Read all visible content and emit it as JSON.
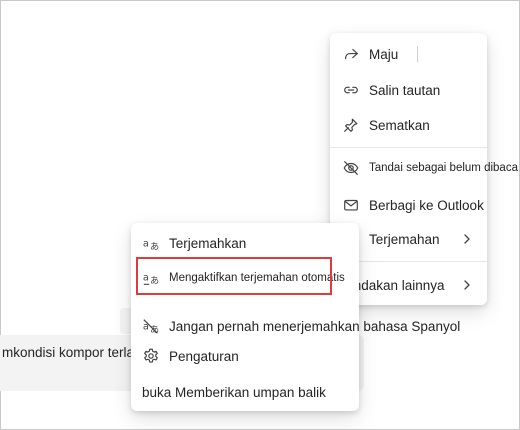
{
  "message": {
    "text": "mkondisi kompor terlalu"
  },
  "main_menu": {
    "forward": "Maju",
    "copy_link": "Salin tautan",
    "pin": "Sematkan",
    "mark_unread": "Tandai sebagai belum dibaca",
    "share_outlook": "Berbagi ke Outlook",
    "translation": "Terjemahan",
    "more_actions": "Tindakan lainnya"
  },
  "translate_submenu": {
    "translate": "Terjemahkan",
    "auto_translate": "Mengaktifkan terjemahan otomatis",
    "never_translate": "Jangan pernah menerjemahkan bahasa Spanyol",
    "settings": "Pengaturan",
    "feedback": "buka Memberikan umpan balik"
  },
  "colors": {
    "highlight_border": "#e03a3a",
    "menu_background": "#ffffff",
    "message_background": "#f3f3f3",
    "accent": "#5b5fc7"
  },
  "icons": {
    "forward": "forward-arrow-icon",
    "copy_link": "link-icon",
    "pin": "pin-icon",
    "mark_unread": "eye-off-icon",
    "share_outlook": "mail-icon",
    "translation": "translate-icon",
    "auto_translate": "auto-translate-icon",
    "never_translate": "translate-off-icon",
    "settings": "gear-icon",
    "chevron": "chevron-right-icon"
  }
}
